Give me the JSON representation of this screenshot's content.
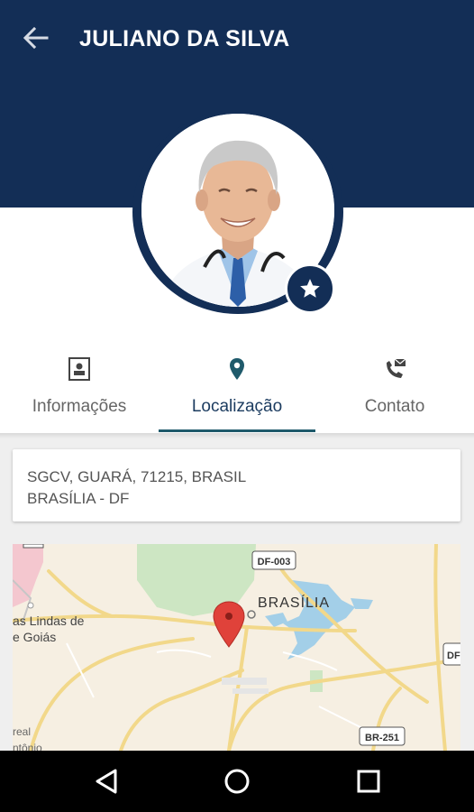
{
  "header": {
    "title": "JULIANO DA SILVA",
    "back_icon": "arrow-left-icon",
    "background_color": "#132e56"
  },
  "profile": {
    "favorite_icon": "star-icon"
  },
  "tabs": [
    {
      "label": "Informações",
      "icon": "contact-card-icon",
      "active": false
    },
    {
      "label": "Localização",
      "icon": "location-pin-icon",
      "active": true
    },
    {
      "label": "Contato",
      "icon": "phone-mail-icon",
      "active": false
    }
  ],
  "address": {
    "line1": "SGCV, GUARÁ, 71215, BRASIL",
    "line2": "BRASÍLIA - DF"
  },
  "map": {
    "city_label": "BRASÍLIA",
    "place_label_1": "as Lindas de",
    "place_label_2": "e Goiás",
    "place_label_3": "real",
    "place_label_4": "ntônio",
    "road_shields": [
      "DF-003",
      "BR-251",
      "DF"
    ],
    "marker_color": "#e0423a"
  },
  "navigation_bar": {
    "back_icon": "nav-back-icon",
    "home_icon": "nav-home-icon",
    "recents_icon": "nav-recents-icon"
  }
}
